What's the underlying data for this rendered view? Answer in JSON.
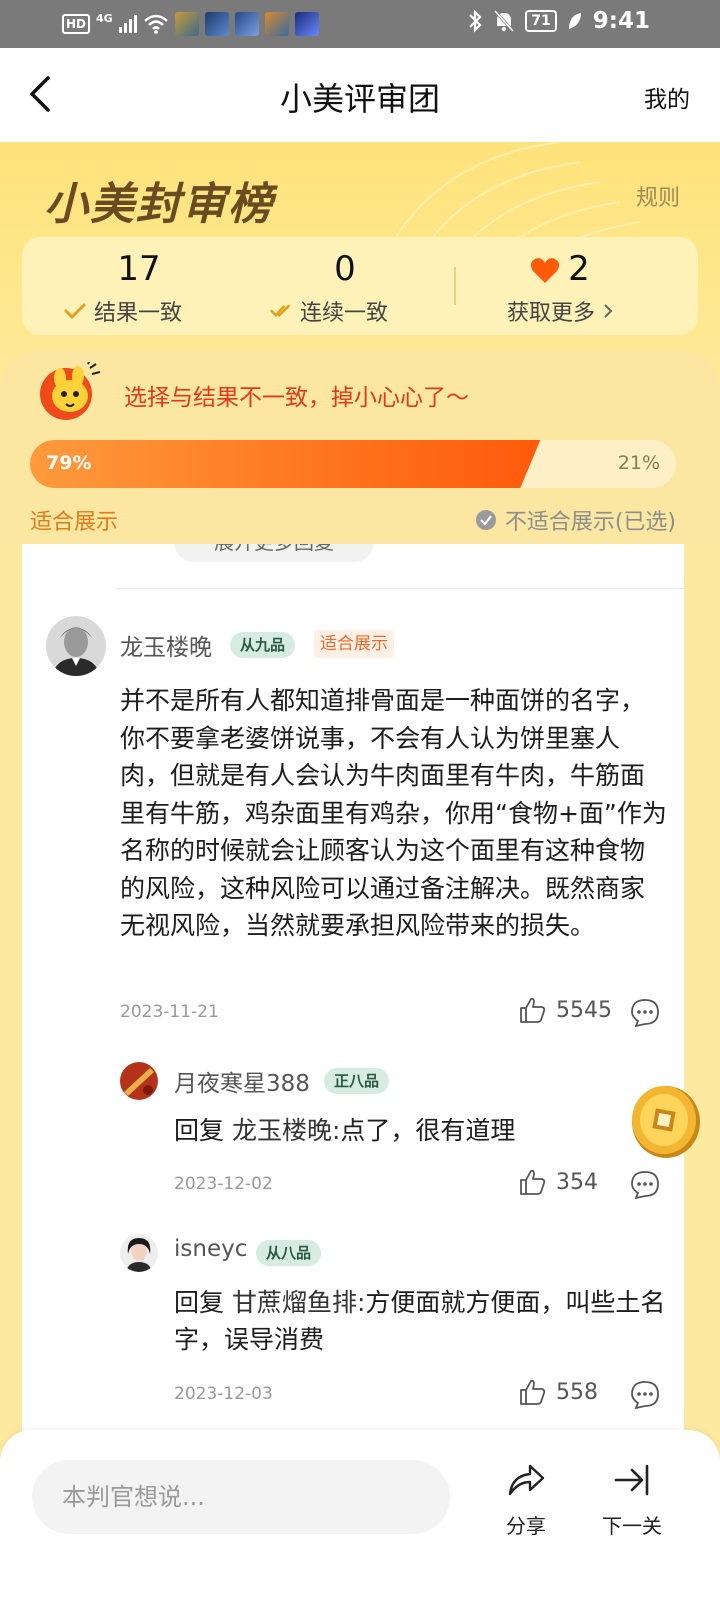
{
  "status_bar": {
    "hd": "HD",
    "network": "4G",
    "battery": "71",
    "time": "9:41"
  },
  "nav": {
    "title": "小美评审团",
    "mine": "我的"
  },
  "hero": {
    "title": "小美封审榜",
    "rules": "规则"
  },
  "stats": {
    "match_count": "17",
    "match_label": "结果一致",
    "streak_count": "0",
    "streak_label": "连续一致",
    "hearts": "2",
    "get_more": "获取更多"
  },
  "verdict": {
    "message": "选择与结果不一致，掉小心心了～",
    "left_pct": "79%",
    "right_pct": "21%",
    "left_fraction": 0.79,
    "left_option": "适合展示",
    "right_option": "不适合展示(已选)"
  },
  "comments": {
    "expand_more": "展开更多回复",
    "main": {
      "username": "龙玉楼晚",
      "rank": "从九品",
      "tag": "适合展示",
      "body": "并不是所有人都知道排骨面是一种面饼的名字，你不要拿老婆饼说事，不会有人认为饼里塞人肉，但就是有人会认为牛肉面里有牛肉，牛筋面里有牛筋，鸡杂面里有鸡杂，你用“食物+面”作为名称的时候就会让顾客认为这个面里有这种食物的风险，这种风险可以通过备注解决。既然商家无视风险，当然就要承担风险带来的损失。",
      "date": "2023-11-21",
      "likes": "5545"
    },
    "replies": [
      {
        "username": "月夜寒星388",
        "rank": "正八品",
        "reply_word": "回复",
        "reply_to": "龙玉楼晚:",
        "text": "点了，很有道理",
        "date": "2023-12-02",
        "likes": "354"
      },
      {
        "username": "isneyc",
        "rank": "从八品",
        "reply_word": "回复",
        "reply_to": "甘蔗熘鱼排:",
        "text": "方便面就方便面，叫些土名字，误导消费",
        "date": "2023-12-03",
        "likes": "558"
      }
    ]
  },
  "bottom": {
    "input_placeholder": "本判官想说...",
    "share": "分享",
    "next": "下一关"
  },
  "colors": {
    "accent_orange": "#ff5a0a",
    "warning_red": "#e2391a",
    "hero_yellow": "#ffe27a"
  }
}
